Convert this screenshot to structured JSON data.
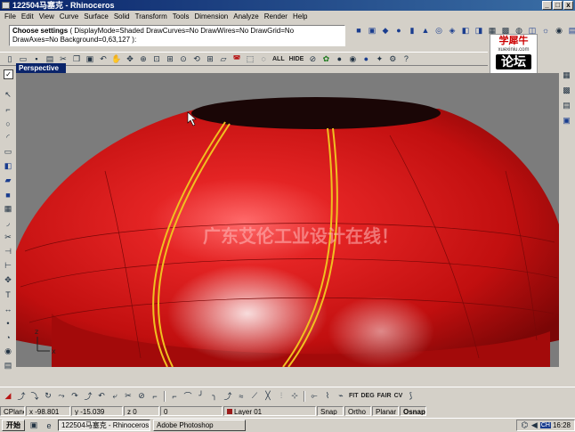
{
  "window": {
    "title": "122504马塞克 - Rhinoceros",
    "min": "_",
    "max": "□",
    "close": "x"
  },
  "menu": [
    "File",
    "Edit",
    "View",
    "Curve",
    "Surface",
    "Solid",
    "Transform",
    "Tools",
    "Dimension",
    "Analyze",
    "Render",
    "Help"
  ],
  "command": {
    "prompt": "Choose settings",
    "line1": "( DisplayMode=Shaded  DrawCurves=No  DrawWires=No  DrawGrid=No",
    "line2": "DrawAxes=No  Background=0,63,127 ):"
  },
  "toolbar_labels": {
    "all": "ALL",
    "hide": "HIDE"
  },
  "logo": {
    "title": "学犀牛",
    "domain": "xuexiniu.com",
    "sub": "论坛"
  },
  "viewport": {
    "name": "Perspective",
    "watermark": "广东艾伦工业设计在线！",
    "axis_x": "x",
    "axis_y": "y",
    "axis_z": "z"
  },
  "bottom_labels": {
    "fit": "FIT",
    "deg": "DEG",
    "fair": "FAIR",
    "cv": "CV"
  },
  "status": {
    "cplane": "CPlane",
    "x": "x -98.801",
    "y": "y -15.039",
    "z": "z 0",
    "extra": "0",
    "layer": "Layer 01",
    "snap": "Snap",
    "ortho": "Ortho",
    "planar": "Planar",
    "osnap": "Osnap"
  },
  "taskbar": {
    "start": "开始",
    "tasks": [
      "122504马塞克 - Rhinoceros",
      "Adobe Photoshop"
    ],
    "ime": "CH",
    "time": "16:28"
  },
  "colors": {
    "surface_red": "#d21010",
    "viewport_bg": "#7c7c7c",
    "edge_yellow": "#f0c020",
    "titlebar": "#0a246a"
  }
}
